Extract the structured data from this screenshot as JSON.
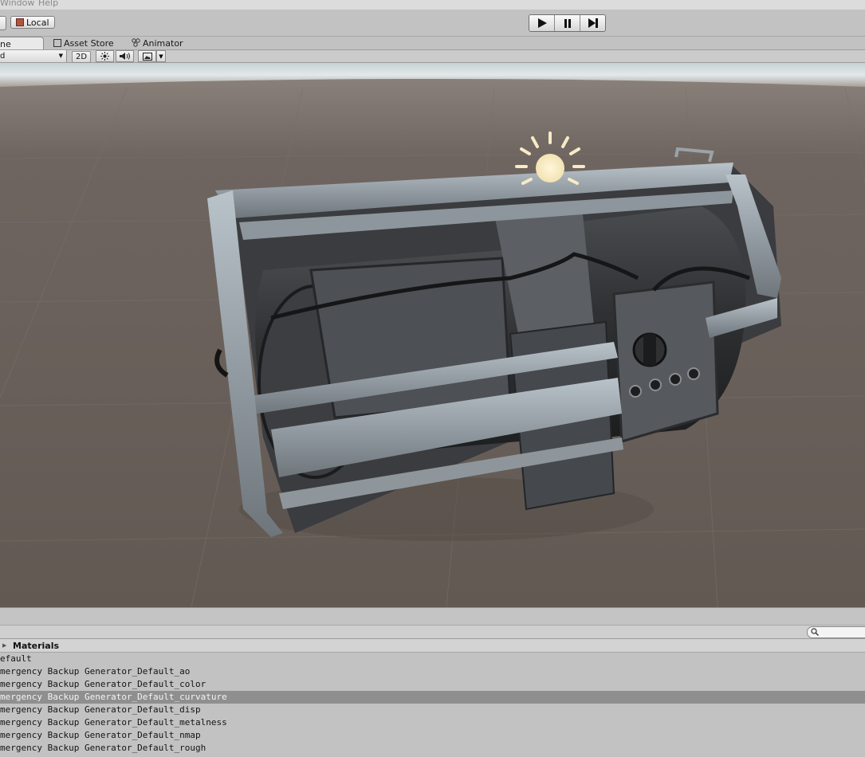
{
  "menu": {
    "window": "Window",
    "help": "Help"
  },
  "toolbar": {
    "pivot_label": "Local"
  },
  "tabs": [
    {
      "label": "ne"
    },
    {
      "label": "Asset Store"
    },
    {
      "label": "Animator"
    }
  ],
  "scene_options": {
    "draw_mode": "d",
    "mode_2d": "2D"
  },
  "project": {
    "section_title": "Materials",
    "items": [
      "efault",
      "mergency Backup Generator_Default_ao",
      "mergency Backup Generator_Default_color",
      "mergency Backup Generator_Default_curvature",
      "mergency Backup Generator_Default_disp",
      "mergency Backup Generator_Default_metalness",
      "mergency Backup Generator_Default_nmap",
      "mergency Backup Generator_Default_rough"
    ],
    "selected_index": 3
  },
  "colors": {
    "viewport_ground": "#685e58",
    "sky": "#d9e3e4",
    "selection": "#8f8f8f"
  },
  "icons": [
    "cube-icon",
    "play-icon",
    "pause-icon",
    "step-icon",
    "asset-store-icon",
    "animator-icon",
    "sun-icon",
    "audio-icon",
    "image-icon",
    "search-icon",
    "triangle-right-icon"
  ]
}
